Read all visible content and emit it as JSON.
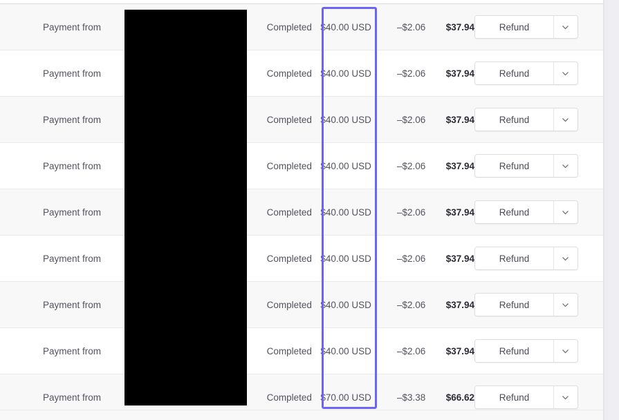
{
  "table": {
    "columns": [
      "description",
      "counterparty",
      "status",
      "gross_amount",
      "fee",
      "net_amount",
      "action"
    ],
    "rows": [
      {
        "description": "Payment from",
        "counterparty": "",
        "status": "Completed",
        "gross_amount": "$40.00 USD",
        "fee": "–$2.06",
        "net_amount": "$37.94",
        "action_label": "Refund"
      },
      {
        "description": "Payment from",
        "counterparty": "",
        "status": "Completed",
        "gross_amount": "$40.00 USD",
        "fee": "–$2.06",
        "net_amount": "$37.94",
        "action_label": "Refund"
      },
      {
        "description": "Payment from",
        "counterparty": "",
        "status": "Completed",
        "gross_amount": "$40.00 USD",
        "fee": "–$2.06",
        "net_amount": "$37.94",
        "action_label": "Refund"
      },
      {
        "description": "Payment from",
        "counterparty": "",
        "status": "Completed",
        "gross_amount": "$40.00 USD",
        "fee": "–$2.06",
        "net_amount": "$37.94",
        "action_label": "Refund"
      },
      {
        "description": "Payment from",
        "counterparty": "",
        "status": "Completed",
        "gross_amount": "$40.00 USD",
        "fee": "–$2.06",
        "net_amount": "$37.94",
        "action_label": "Refund"
      },
      {
        "description": "Payment from",
        "counterparty": "",
        "status": "Completed",
        "gross_amount": "$40.00 USD",
        "fee": "–$2.06",
        "net_amount": "$37.94",
        "action_label": "Refund"
      },
      {
        "description": "Payment from",
        "counterparty": "",
        "status": "Completed",
        "gross_amount": "$40.00 USD",
        "fee": "–$2.06",
        "net_amount": "$37.94",
        "action_label": "Refund"
      },
      {
        "description": "Payment from",
        "counterparty": "",
        "status": "Completed",
        "gross_amount": "$40.00 USD",
        "fee": "–$2.06",
        "net_amount": "$37.94",
        "action_label": "Refund"
      },
      {
        "description": "Payment from",
        "counterparty": "",
        "status": "Completed",
        "gross_amount": "$70.00 USD",
        "fee": "–$3.38",
        "net_amount": "$66.62",
        "action_label": "Refund"
      }
    ]
  },
  "annotation": {
    "highlight_color": "#6c63f7",
    "highlight_target_column": "gross_amount"
  },
  "redaction": {
    "color": "#000000",
    "covers_column": "counterparty"
  },
  "icons": {
    "caret": "chevron-down-icon"
  },
  "colors": {
    "row_alt_background": "#f8f8f9",
    "row_background": "#ffffff",
    "row_divider": "#eaeaee",
    "text_primary": "#2b2b36",
    "text_secondary": "#53535f",
    "button_border": "#dcdce2",
    "gutter": "#efeff3"
  }
}
